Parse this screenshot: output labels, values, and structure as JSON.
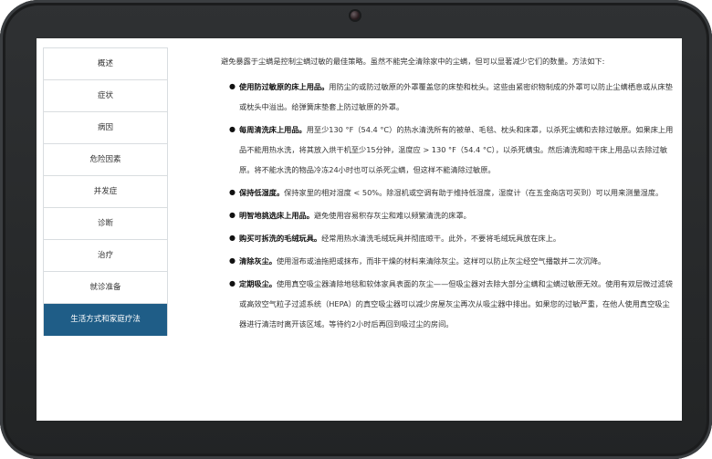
{
  "sidebar": {
    "items": [
      {
        "label": "概述"
      },
      {
        "label": "症状"
      },
      {
        "label": "病因"
      },
      {
        "label": "危险因素"
      },
      {
        "label": "并发症"
      },
      {
        "label": "诊断"
      },
      {
        "label": "治疗"
      },
      {
        "label": "就诊准备"
      },
      {
        "label": "生活方式和家庭疗法",
        "active": true
      }
    ]
  },
  "content": {
    "intro": "避免暴露于尘螨是控制尘螨过敏的最佳策略。虽然不能完全清除家中的尘螨，但可以显著减少它们的数量。方法如下:",
    "items": [
      {
        "term": "使用防过敏原的床上用品。",
        "text": "用防尘的或防过敏原的外罩覆盖您的床垫和枕头。这些由紧密织物制成的外罩可以防止尘螨栖息或从床垫或枕头中溢出。给弹簧床垫套上防过敏原的外罩。"
      },
      {
        "term": "每周清洗床上用品。",
        "text": "用至少130 °F（54.4 °C）的热水清洗所有的被单、毛毯、枕头和床罩，以杀死尘螨和去除过敏原。如果床上用品不能用热水洗，将其放入烘干机至少15分钟，温度应 > 130 °F（54.4 °C），以杀死螨虫。然后清洗和晾干床上用品以去除过敏原。将不能水洗的物品冷冻24小时也可以杀死尘螨，但这样不能清除过敏原。"
      },
      {
        "term": "保持低湿度。",
        "text": "保持家里的相对湿度 < 50%。除湿机或空调有助于维持低湿度，湿度计（在五金商店可买到）可以用来测量湿度。"
      },
      {
        "term": "明智地挑选床上用品。",
        "text": "避免使用容易积存灰尘和难以频繁清洗的床罩。"
      },
      {
        "term": "购买可拆洗的毛绒玩具。",
        "text": "经常用热水清洗毛绒玩具并彻底晾干。此外，不要将毛绒玩具放在床上。"
      },
      {
        "term": "清除灰尘。",
        "text": "使用湿布或油拖把或抹布，而非干燥的材料来清除灰尘。这样可以防止灰尘经空气播散并二次沉降。"
      },
      {
        "term": "定期吸尘。",
        "text": "使用真空吸尘器清除地毯和软体家具表面的灰尘——但吸尘器对去除大部分尘螨和尘螨过敏原无效。使用有双层微过滤袋或高效空气粒子过滤系统（HEPA）的真空吸尘器可以减少房屋灰尘再次从吸尘器中排出。如果您的过敏严重，在他人使用真空吸尘器进行清洁时离开该区域。等待约2小时后再回到吸过尘的房间。"
      }
    ]
  }
}
